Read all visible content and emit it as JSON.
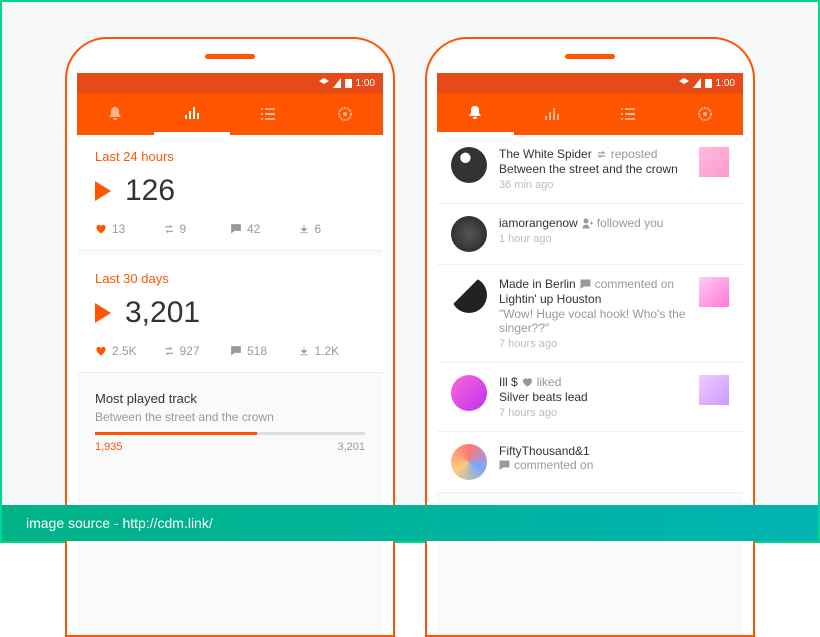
{
  "statusbar": {
    "time": "1:00"
  },
  "left": {
    "section24": {
      "label": "Last 24 hours",
      "plays": "126",
      "likes": "13",
      "reposts": "9",
      "comments": "42",
      "downloads": "6"
    },
    "section30": {
      "label": "Last 30 days",
      "plays": "3,201",
      "likes": "2.5K",
      "reposts": "927",
      "comments": "518",
      "downloads": "1.2K"
    },
    "mostPlayed": {
      "title": "Most played track",
      "track": "Between the street and the crown",
      "current": "1,935",
      "max": "3,201"
    }
  },
  "right": {
    "items": [
      {
        "name": "The White Spider",
        "action": "reposted",
        "subject": "Between the street and the crown",
        "time": "36 min ago",
        "quote": ""
      },
      {
        "name": "iamorangenow",
        "action": "followed you",
        "subject": "",
        "time": "1 hour ago",
        "quote": ""
      },
      {
        "name": "Made in Berlin",
        "action": "commented on",
        "subject": "Lightin' up Houston",
        "quote": "\"Wow! Huge vocal hook! Who's the singer??\"",
        "time": "7 hours ago"
      },
      {
        "name": "Ill $",
        "action": "liked",
        "subject": "Silver beats lead",
        "time": "7 hours ago",
        "quote": ""
      },
      {
        "name": "FiftyThousand&1",
        "action": "commented on",
        "subject": "",
        "time": "",
        "quote": ""
      }
    ]
  },
  "footer": {
    "text": "image source - http://cdm.link/"
  }
}
